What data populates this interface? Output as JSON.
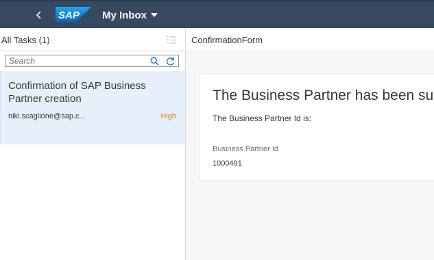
{
  "shell": {
    "logo_text": "SAP",
    "app_title": "My Inbox",
    "icons": [
      "chevron-left-icon",
      "caret-down-icon"
    ]
  },
  "master": {
    "title": "All Tasks (1)",
    "search_placeholder": "Search",
    "search_value": "",
    "icons": [
      "sort-icon",
      "search-icon",
      "refresh-icon"
    ],
    "tasks": [
      {
        "title": "Confirmation of SAP Business Partner creation",
        "user": "niki.scaglione@sap.c...",
        "priority": "High"
      }
    ]
  },
  "detail": {
    "title": "ConfirmationForm",
    "heading": "The Business Partner has been succ",
    "subheading": "The Business Partner Id is:",
    "field_label": "Business Partner Id",
    "field_value": "1000491"
  },
  "colors": {
    "shell_bg": "#354a5f",
    "selected_item_bg": "#e5f0fa",
    "priority_high": "#e9730c",
    "accent_blue": "#0a6ed1"
  }
}
